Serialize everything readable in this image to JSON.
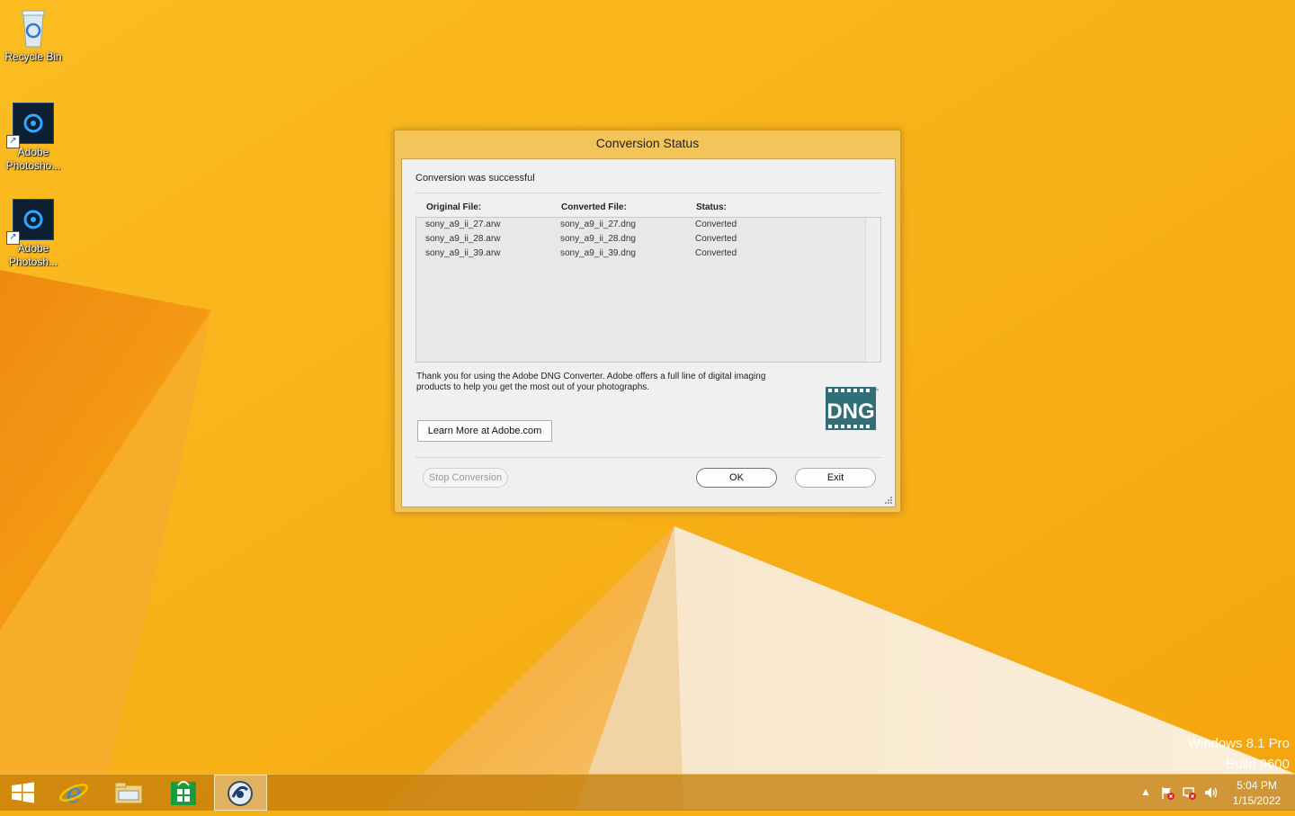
{
  "desktop": {
    "icons": [
      {
        "label": "Recycle Bin",
        "icon": "recycle-bin-icon"
      },
      {
        "label": "Adobe Photosho...",
        "icon": "adobe-photoshop-icon"
      },
      {
        "label": "Adobe Photosh...",
        "icon": "adobe-photoshop-icon"
      }
    ],
    "watermark": {
      "line1": "Windows 8.1 Pro",
      "line2": "Build 9600"
    }
  },
  "dialog": {
    "title": "Conversion Status",
    "status_message": "Conversion was successful",
    "columns": {
      "original": "Original File:",
      "converted": "Converted File:",
      "status": "Status:"
    },
    "rows": [
      {
        "original": "sony_a9_ii_27.arw",
        "converted": "sony_a9_ii_27.dng",
        "status": "Converted"
      },
      {
        "original": "sony_a9_ii_28.arw",
        "converted": "sony_a9_ii_28.dng",
        "status": "Converted"
      },
      {
        "original": "sony_a9_ii_39.arw",
        "converted": "sony_a9_ii_39.dng",
        "status": "Converted"
      }
    ],
    "thanks_text": "Thank you for using the Adobe DNG Converter.  Adobe offers a full line of digital imaging products to help you get the most out of your photographs.",
    "learn_more_label": "Learn More at Adobe.com",
    "stop_label": "Stop Conversion",
    "ok_label": "OK",
    "exit_label": "Exit",
    "logo_text": "DNG",
    "logo_tm": "™"
  },
  "taskbar": {
    "buttons": [
      "start-button",
      "internet-explorer",
      "file-explorer",
      "store",
      "dng-converter"
    ],
    "clock": {
      "time": "5:04 PM",
      "date": "1/15/2022"
    }
  },
  "colors": {
    "wallpaper": "#f7b016",
    "dialog_frame": "#f2c459",
    "dng_teal": "#2f6f7a"
  }
}
